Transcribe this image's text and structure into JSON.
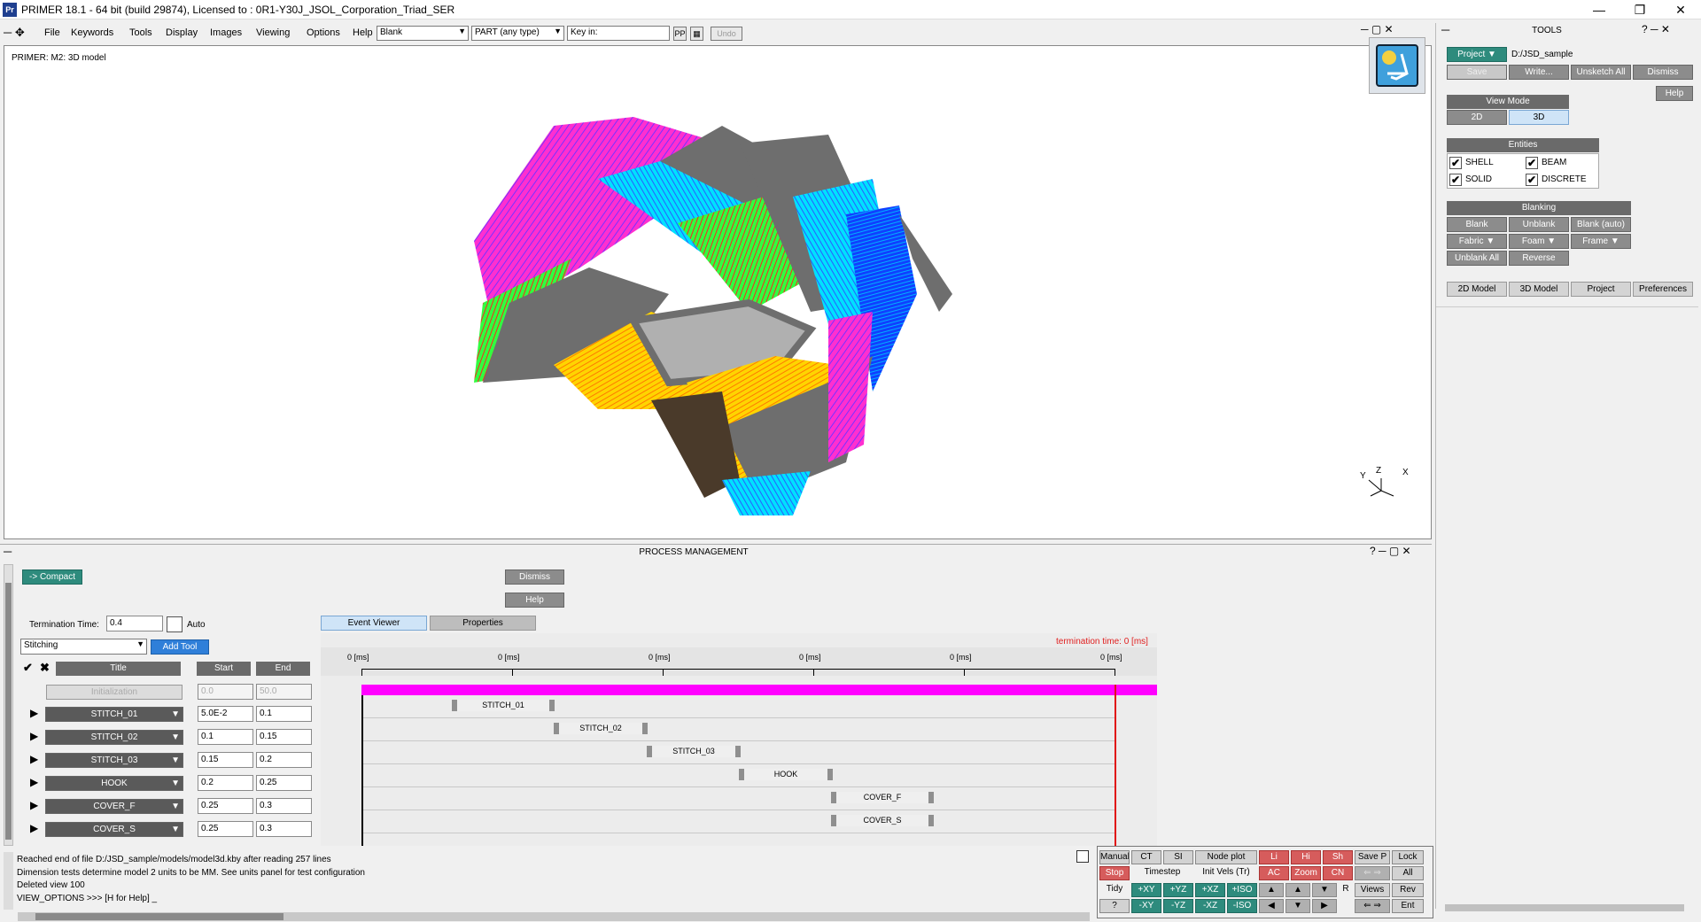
{
  "window": {
    "app_icon": "Pr",
    "title": "PRIMER 18.1 - 64 bit (build 29874), Licensed to : 0R1-Y30J_JSOL_Corporation_Triad_SER",
    "min": "—",
    "max": "❐",
    "close": "✕"
  },
  "menubar": {
    "items": [
      "File",
      "Keywords",
      "Tools",
      "Display",
      "Images",
      "Viewing",
      "Options",
      "Help"
    ],
    "blank_combo": "Blank",
    "part_combo": "PART  (any type)",
    "key_in": "Key in:",
    "pp": "PP",
    "undo": "Undo"
  },
  "viewport": {
    "label": "PRIMER: M2: 3D model",
    "triad_y": "Y",
    "triad_z": "Z",
    "triad_x": "X"
  },
  "process": {
    "header": "PROCESS MANAGEMENT",
    "compact": "-> Compact",
    "dismiss": "Dismiss",
    "help": "Help",
    "termination_label": "Termination Time:",
    "termination_value": "0.4",
    "auto_label": "Auto",
    "tool_select": "Stitching",
    "add_tool": "Add Tool",
    "tab_event": "Event Viewer",
    "tab_props": "Properties",
    "termination_time_text": "termination time: 0 [ms]",
    "col_title": "Title",
    "col_start": "Start",
    "col_end": "End",
    "ticks": [
      "0 [ms]",
      "0 [ms]",
      "0 [ms]",
      "0 [ms]",
      "0 [ms]",
      "0 [ms]"
    ],
    "init_row": {
      "title": "Initialization",
      "start": "0.0",
      "end": "50.0"
    },
    "rows": [
      {
        "title": "STITCH_01",
        "start": "5.0E-2",
        "end": "0.1",
        "tag": "STITCH_01"
      },
      {
        "title": "STITCH_02",
        "start": "0.1",
        "end": "0.15",
        "tag": "STITCH_02"
      },
      {
        "title": "STITCH_03",
        "start": "0.15",
        "end": "0.2",
        "tag": "STITCH_03"
      },
      {
        "title": "HOOK",
        "start": "0.2",
        "end": "0.25",
        "tag": "HOOK"
      },
      {
        "title": "COVER_F",
        "start": "0.25",
        "end": "0.3",
        "tag": "COVER_F"
      },
      {
        "title": "COVER_S",
        "start": "0.25",
        "end": "0.3",
        "tag": "COVER_S"
      }
    ]
  },
  "tools": {
    "header": "TOOLS",
    "project_btn": "Project",
    "project_path": "D:/JSD_sample",
    "save": "Save",
    "write": "Write...",
    "unsketch": "Unsketch All",
    "dismiss": "Dismiss",
    "help": "Help",
    "view_mode": "View Mode",
    "mode_2d": "2D",
    "mode_3d": "3D",
    "entities": "Entities",
    "ent_shell": "SHELL",
    "ent_beam": "BEAM",
    "ent_solid": "SOLID",
    "ent_discrete": "DISCRETE",
    "blanking": "Blanking",
    "blank": "Blank",
    "unblank": "Unblank",
    "blank_auto": "Blank (auto)",
    "fabric": "Fabric",
    "foam": "Foam",
    "frame": "Frame",
    "unblank_all": "Unblank All",
    "reverse": "Reverse",
    "tab_2d": "2D Model",
    "tab_3d": "3D Model",
    "tab_project": "Project",
    "tab_prefs": "Preferences"
  },
  "console": {
    "lines": [
      "Reached end of file D:/JSD_sample/models/model3d.kby after reading 257 lines",
      "Dimension tests determine model 2 units to be MM. See units panel for test configuration",
      "Deleted view 100",
      "VIEW_OPTIONS >>> [H for Help] _"
    ]
  },
  "quick": {
    "row1": [
      "Manual",
      "CT",
      "SI",
      "Node plot",
      "Li",
      "Hi",
      "Sh",
      "Save P",
      "Lock"
    ],
    "row2": [
      "Stop",
      "Timestep",
      "Init Vels (Tr)",
      "AC",
      "Zoom",
      "CN",
      "All"
    ],
    "row3": [
      "Tidy",
      "+XY",
      "+YZ",
      "+XZ",
      "+ISO",
      "R",
      "Views",
      "Rev"
    ],
    "row4": [
      "?",
      "-XY",
      "-YZ",
      "-XZ",
      "-ISO",
      "Ent"
    ]
  },
  "colors": {
    "timeline_bar": "#ff00ff",
    "end_line": "#e01010",
    "teal": "#2e8b7d",
    "accent_blue": "#2f7fd9"
  }
}
